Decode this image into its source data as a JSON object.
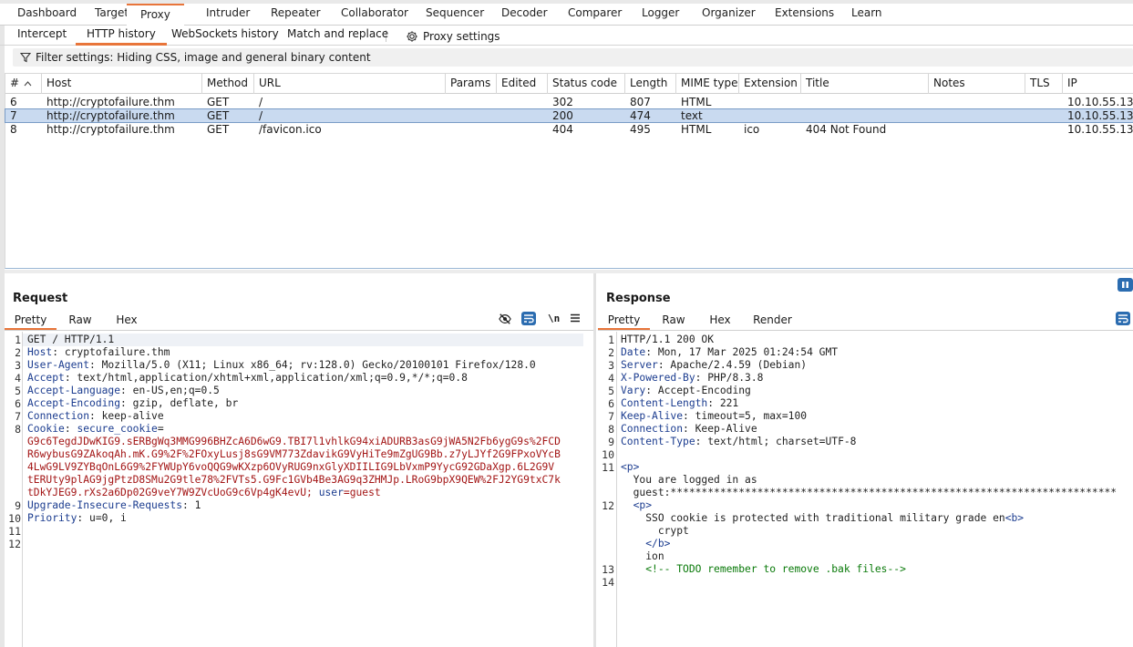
{
  "top_tabs": [
    "Dashboard",
    "Target",
    "Proxy",
    "Intruder",
    "Repeater",
    "Collaborator",
    "Sequencer",
    "Decoder",
    "Comparer",
    "Logger",
    "Organizer",
    "Extensions",
    "Learn"
  ],
  "active_top_tab": "Proxy",
  "proxy_tabs": [
    "Intercept",
    "HTTP history",
    "WebSockets history",
    "Match and replace"
  ],
  "proxy_settings_label": "Proxy settings",
  "active_proxy_tab": "HTTP history",
  "filter_text": "Filter settings: Hiding CSS, image and general binary content",
  "columns": [
    "#",
    "Host",
    "Method",
    "URL",
    "Params",
    "Edited",
    "Status code",
    "Length",
    "MIME type",
    "Extension",
    "Title",
    "Notes",
    "TLS",
    "IP"
  ],
  "rows": [
    {
      "num": "6",
      "host": "http://cryptofailure.thm",
      "method": "GET",
      "url": "/",
      "status": "302",
      "length": "807",
      "mime": "HTML",
      "ext": "",
      "title": "",
      "ip": "10.10.55.135"
    },
    {
      "num": "7",
      "host": "http://cryptofailure.thm",
      "method": "GET",
      "url": "/",
      "status": "200",
      "length": "474",
      "mime": "text",
      "ext": "",
      "title": "",
      "ip": "10.10.55.135"
    },
    {
      "num": "8",
      "host": "http://cryptofailure.thm",
      "method": "GET",
      "url": "/favicon.ico",
      "status": "404",
      "length": "495",
      "mime": "HTML",
      "ext": "ico",
      "title": "404 Not Found",
      "ip": "10.10.55.135"
    }
  ],
  "selected_row": "7",
  "request": {
    "title": "Request",
    "tabs": [
      "Pretty",
      "Raw",
      "Hex"
    ],
    "active_tab": "Pretty",
    "newline_toggle": "\\n",
    "lines": [
      {
        "n": "1",
        "plain": "GET / HTTP/1.1"
      },
      {
        "n": "2",
        "key": "Host",
        "val": " cryptofailure.thm"
      },
      {
        "n": "3",
        "key": "User-Agent",
        "val": " Mozilla/5.0 (X11; Linux x86_64; rv:128.0) Gecko/20100101 Firefox/128.0"
      },
      {
        "n": "4",
        "key": "Accept",
        "val": " text/html,application/xhtml+xml,application/xml;q=0.9,*/*;q=0.8"
      },
      {
        "n": "5",
        "key": "Accept-Language",
        "val": " en-US,en;q=0.5"
      },
      {
        "n": "6",
        "key": "Accept-Encoding",
        "val": " gzip, deflate, br"
      },
      {
        "n": "7",
        "key": "Connection",
        "val": " keep-alive"
      },
      {
        "n": "8",
        "key": "Cookie",
        "val": " ",
        "cookie_name": "secure_cookie",
        "cookie_eq": "="
      },
      {
        "n": "",
        "cookie_value": "G9c6TegdJDwKIG9.sERBgWq3MMG996BHZcA6D6wG9.TBI7l1vhlkG94xiADURB3asG9jWA5N2Fb6ygG9s%2FCD"
      },
      {
        "n": "",
        "cookie_value": "R6wybusG9ZAkoqAh.mK.G9%2F%2FOxyLusj8sG9VM773ZdavikG9VyHiTe9mZgUG9Bb.z7yLJYf2G9FPxoVYcB"
      },
      {
        "n": "",
        "cookie_value": "4LwG9LV9ZYBqOnL6G9%2FYWUpY6voQQG9wKXzp6OVyRUG9nxGlyXDIILIG9LbVxmP9YycG92GDaXgp.6L2G9V"
      },
      {
        "n": "",
        "cookie_value": "tERUty9plAG9jgPtzD8SMu2G9tle78%2FVTs5.G9Fc1GVb4Be3AG9q3ZHMJp.LRoG9bpX9QEW%2FJ2YG9txC7k"
      },
      {
        "n": "",
        "cookie_value": "tDkYJEG9.rXs2a6Dp02G9veY7W9ZVcUoG9c6Vp4gK4evU;",
        "cookie_user": "user",
        "cookie_user_val": "=guest"
      },
      {
        "n": "9",
        "key": "Upgrade-Insecure-Requests",
        "val": " 1"
      },
      {
        "n": "10",
        "key": "Priority",
        "val": " u=0, i"
      },
      {
        "n": "11",
        "plain": ""
      },
      {
        "n": "12",
        "plain": ""
      }
    ]
  },
  "response": {
    "title": "Response",
    "tabs": [
      "Pretty",
      "Raw",
      "Hex",
      "Render"
    ],
    "active_tab": "Pretty",
    "lines": [
      {
        "n": "1",
        "plain": "HTTP/1.1 200 OK"
      },
      {
        "n": "2",
        "key": "Date",
        "val": " Mon, 17 Mar 2025 01:24:54 GMT"
      },
      {
        "n": "3",
        "key": "Server",
        "val": " Apache/2.4.59 (Debian)"
      },
      {
        "n": "4",
        "key": "X-Powered-By",
        "val": " PHP/8.3.8"
      },
      {
        "n": "5",
        "key": "Vary",
        "val": " Accept-Encoding"
      },
      {
        "n": "6",
        "key": "Content-Length",
        "val": " 221"
      },
      {
        "n": "7",
        "key": "Keep-Alive",
        "val": " timeout=5, max=100"
      },
      {
        "n": "8",
        "key": "Connection",
        "val": " Keep-Alive"
      },
      {
        "n": "9",
        "key": "Content-Type",
        "val": " text/html; charset=UTF-8"
      },
      {
        "n": "10",
        "plain": ""
      },
      {
        "n": "11",
        "tag": "<p>"
      },
      {
        "n": "",
        "indent": "  ",
        "plain": "You are logged in as"
      },
      {
        "n": "",
        "indent": "  ",
        "plain": "guest:************************************************************************"
      },
      {
        "n": "12",
        "indent": "  ",
        "tag": "<p>"
      },
      {
        "n": "",
        "indent": "    ",
        "plain": "SSO cookie is protected with traditional military grade en",
        "tag_after": "<b>"
      },
      {
        "n": "",
        "indent": "      ",
        "plain": "crypt"
      },
      {
        "n": "",
        "indent": "    ",
        "tag": "</b>"
      },
      {
        "n": "",
        "indent": "    ",
        "plain": "ion"
      },
      {
        "n": "13",
        "indent": "    ",
        "comment": "<!-- TODO remember to remove .bak files-->"
      },
      {
        "n": "14",
        "plain": ""
      }
    ]
  }
}
